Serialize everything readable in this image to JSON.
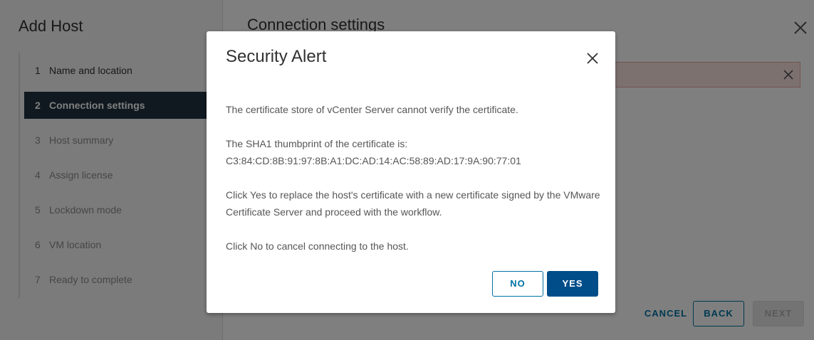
{
  "wizard": {
    "title": "Add Host",
    "heading": "Connection settings",
    "steps": [
      {
        "num": "1",
        "label": "Name and location"
      },
      {
        "num": "2",
        "label": "Connection settings"
      },
      {
        "num": "3",
        "label": "Host summary"
      },
      {
        "num": "4",
        "label": "Assign license"
      },
      {
        "num": "5",
        "label": "Lockdown mode"
      },
      {
        "num": "6",
        "label": "VM location"
      },
      {
        "num": "7",
        "label": "Ready to complete"
      }
    ],
    "buttons": {
      "cancel": "CANCEL",
      "back": "BACK",
      "next": "NEXT"
    }
  },
  "dialog": {
    "title": "Security Alert",
    "line1": "The certificate store of vCenter Server cannot verify the certificate.",
    "thumb_label": "The SHA1 thumbprint of the certificate is:",
    "thumbprint": "C3:84:CD:8B:91:97:8B:A1:DC:AD:14:AC:58:89:AD:17:9A:90:77:01",
    "yes_text": "Click Yes to replace the host's certificate with a new certificate signed by the VMware Certificate Server and proceed with the workflow.",
    "no_text": "Click No to cancel connecting to the host.",
    "btn_no": "NO",
    "btn_yes": "YES"
  },
  "colors": {
    "accent": "#0072a3",
    "primary": "#004d8a",
    "active_step": "#21333f",
    "alert_bg": "#fbe2e0"
  }
}
